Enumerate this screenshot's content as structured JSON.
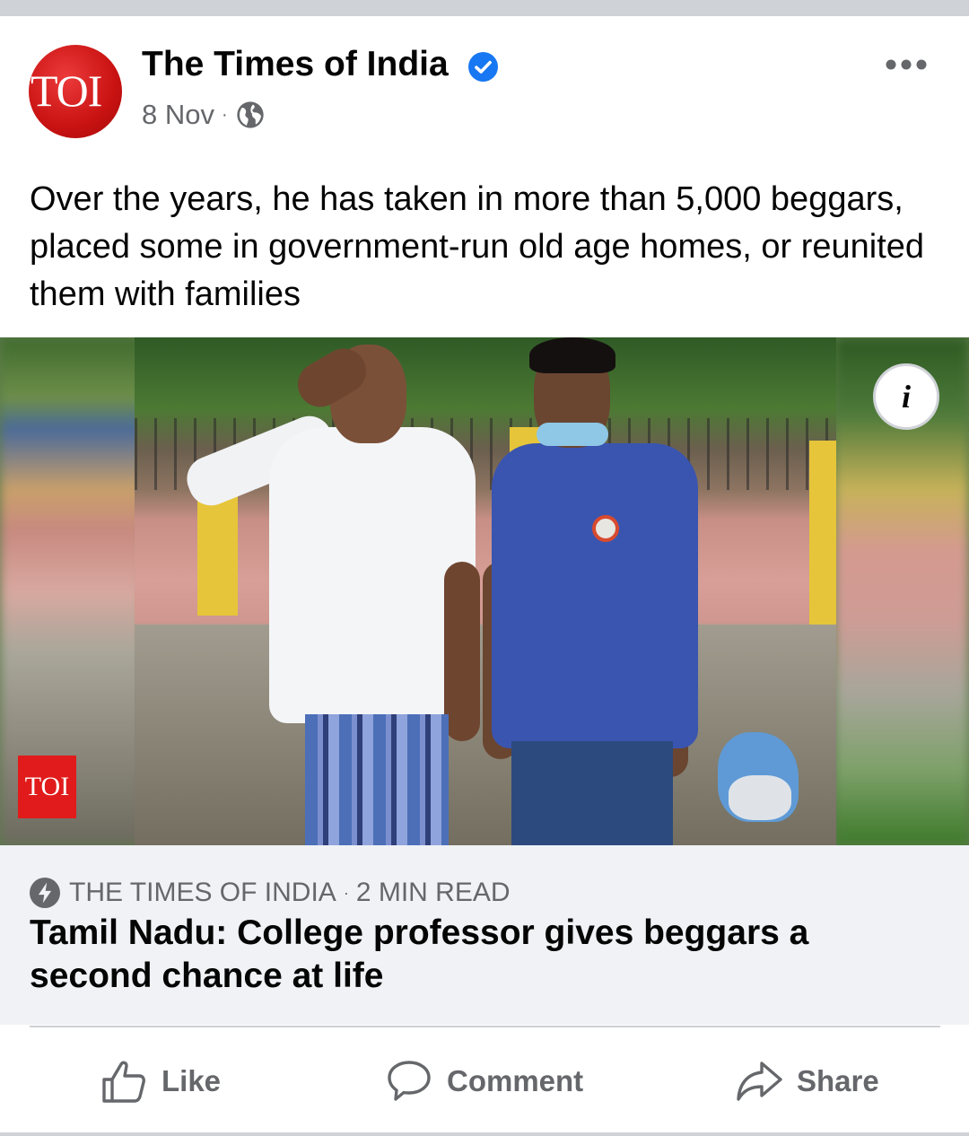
{
  "post": {
    "page_name": "The Times of India",
    "avatar_text": "TOI",
    "date": "8 Nov",
    "separator": "·",
    "text": "Over the years, he has taken in more than 5,000 beggars, placed some in government-run old age homes, or reunited them with families"
  },
  "media": {
    "info_label": "i",
    "watermark": "TOI"
  },
  "link": {
    "source": "THE TIMES OF INDIA",
    "separator": "·",
    "read_time": "2 MIN READ",
    "title": "Tamil Nadu: College professor gives beggars a second chance at life"
  },
  "actions": {
    "like": "Like",
    "comment": "Comment",
    "share": "Share"
  },
  "icons": {
    "verified": "verified-badge-icon",
    "globe": "globe-icon",
    "more": "more-options-icon",
    "bolt": "instant-article-icon",
    "like": "thumbs-up-icon",
    "comment": "speech-bubble-icon",
    "share": "share-arrow-icon"
  },
  "colors": {
    "verified_blue": "#1877f2",
    "secondary_text": "#65676b",
    "toi_red": "#e11b1b",
    "link_bg": "#f0f2f5"
  }
}
